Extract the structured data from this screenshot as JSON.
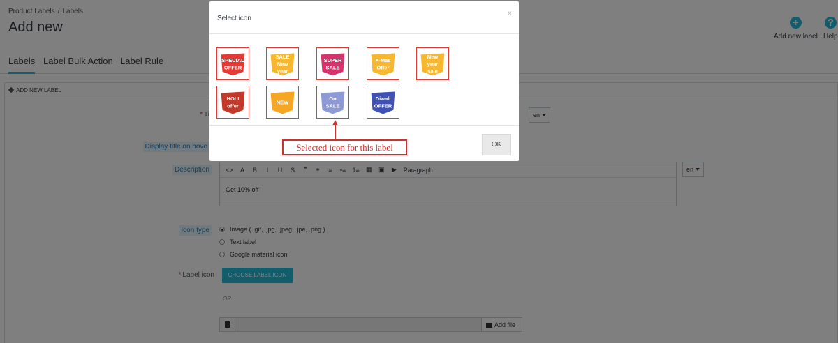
{
  "breadcrumb": [
    "Product Labels",
    "Labels"
  ],
  "page_title": "Add new",
  "toolbar": {
    "add_new_label": "Add new label",
    "help": "Help"
  },
  "tabs": [
    "Labels",
    "Label Bulk Action",
    "Label Rule"
  ],
  "panel": {
    "header": "ADD NEW LABEL"
  },
  "form": {
    "title_label": "Ti",
    "display_title_label": "Display title on hove",
    "description_label": "Description",
    "language": "en",
    "editor_toolbar": [
      "<>",
      "A",
      "B",
      "I",
      "U",
      "S",
      "❞",
      "⚭",
      "≡",
      "•≡",
      "1≡",
      "▦",
      "▣",
      "▶",
      "Paragraph"
    ],
    "description_value": "Get 10% off",
    "icon_type_label": "Icon type",
    "icon_type_options": [
      "Image ( .gif, .jpg, .jpeg, .jpe, .png )",
      "Text label",
      "Google material icon"
    ],
    "icon_type_selected": 0,
    "label_icon_label": "Label icon",
    "choose_icon_button": "CHOOSE LABEL ICON",
    "or_text": "OR",
    "add_file_button": "Add file"
  },
  "modal": {
    "title": "Select icon",
    "close": "×",
    "icons": [
      {
        "name": "special-offer",
        "lines": [
          "SPECIAL",
          "OFFER"
        ],
        "color": "#e53935"
      },
      {
        "name": "sale-new-year",
        "lines": [
          "SALE",
          "New",
          "year"
        ],
        "color": "#f7b731"
      },
      {
        "name": "super-sale",
        "lines": [
          "SUPER",
          "SALE"
        ],
        "color": "#d6336c"
      },
      {
        "name": "x-mas-offer",
        "lines": [
          "X-Mas",
          "Offer"
        ],
        "color": "#f7b731"
      },
      {
        "name": "new-year-sale",
        "lines": [
          "New",
          "year",
          "sale"
        ],
        "color": "#f7b731"
      },
      {
        "name": "holi-offer",
        "lines": [
          "HOLI",
          "offer"
        ],
        "color": "#c0392b"
      },
      {
        "name": "new",
        "lines": [
          "NEW"
        ],
        "color": "#f5a623"
      },
      {
        "name": "on-sale",
        "lines": [
          "On",
          "SALE"
        ],
        "color": "#8e9ad6"
      },
      {
        "name": "diwali-offer",
        "lines": [
          "Diwali",
          "OFFER"
        ],
        "color": "#3f51b5"
      }
    ],
    "ok_button": "OK"
  },
  "annotation": "Selected icon for this label"
}
